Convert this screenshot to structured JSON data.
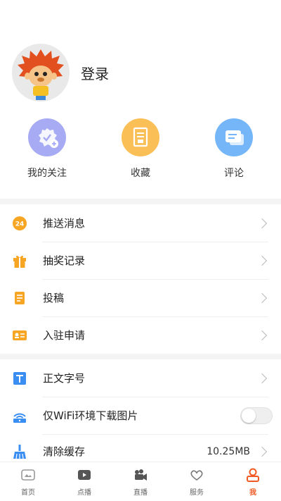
{
  "profile": {
    "login_label": "登录"
  },
  "quick_actions": [
    {
      "label": "我的关注",
      "icon": "follow-badge-icon",
      "color": "#a7abf4"
    },
    {
      "label": "收藏",
      "icon": "bookmark-icon",
      "color": "#fbbf57"
    },
    {
      "label": "评论",
      "icon": "comment-icon",
      "color": "#74b6f7"
    }
  ],
  "menu": {
    "push": {
      "label": "推送消息",
      "icon": "clock-24-icon"
    },
    "lottery": {
      "label": "抽奖记录",
      "icon": "gift-icon"
    },
    "submit": {
      "label": "投稿",
      "icon": "document-icon"
    },
    "apply": {
      "label": "入驻申请",
      "icon": "id-card-icon"
    },
    "font": {
      "label": "正文字号",
      "icon": "text-size-icon"
    },
    "wifi": {
      "label": "仅WiFi环境下载图片",
      "icon": "wifi-image-icon",
      "enabled": false
    },
    "cache": {
      "label": "清除缓存",
      "icon": "broom-icon",
      "value": "10.25MB"
    }
  },
  "tabs": [
    {
      "label": "首页",
      "icon": "home-icon",
      "active": false
    },
    {
      "label": "点播",
      "icon": "play-icon",
      "active": false
    },
    {
      "label": "直播",
      "icon": "live-camera-icon",
      "active": false
    },
    {
      "label": "服务",
      "icon": "heart-hand-icon",
      "active": false
    },
    {
      "label": "我",
      "icon": "user-icon",
      "active": true
    }
  ],
  "colors": {
    "accent": "#f05a22",
    "orange": "#f7a623",
    "blue": "#3a8ef2"
  }
}
